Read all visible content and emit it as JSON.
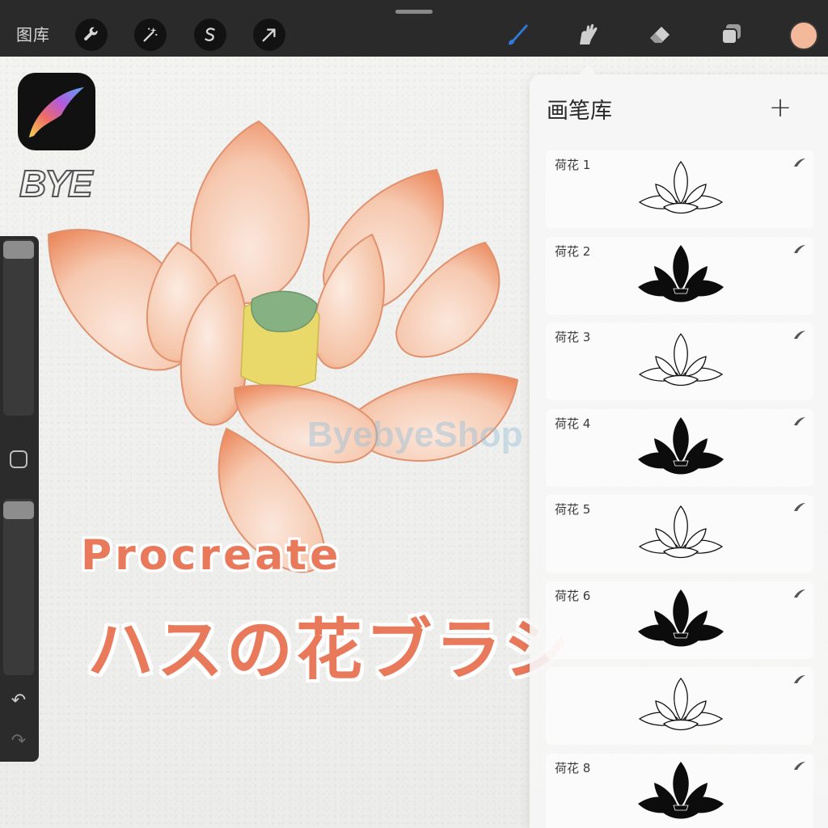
{
  "toolbar": {
    "gallery_label": "图库",
    "color": "#f4b99a",
    "brush_color": "#2f7bd8"
  },
  "brand": "BYE",
  "watermark": "ByebyeShop",
  "headline": {
    "line1": "Procreate",
    "line2": "ハスの花ブラシ"
  },
  "brush_library": {
    "title": "画笔库",
    "add_label": "+",
    "items": [
      {
        "name": "荷花 1",
        "style": "outline"
      },
      {
        "name": "荷花 2",
        "style": "silhouette"
      },
      {
        "name": "荷花 3",
        "style": "outline"
      },
      {
        "name": "荷花 4",
        "style": "silhouette"
      },
      {
        "name": "荷花 5",
        "style": "outline"
      },
      {
        "name": "荷花 6",
        "style": "silhouette"
      },
      {
        "name": "",
        "style": "outline"
      },
      {
        "name": "荷花 8",
        "style": "silhouette"
      }
    ]
  },
  "sidebar": {
    "undo_icon": "↶",
    "redo_icon": "↷"
  }
}
